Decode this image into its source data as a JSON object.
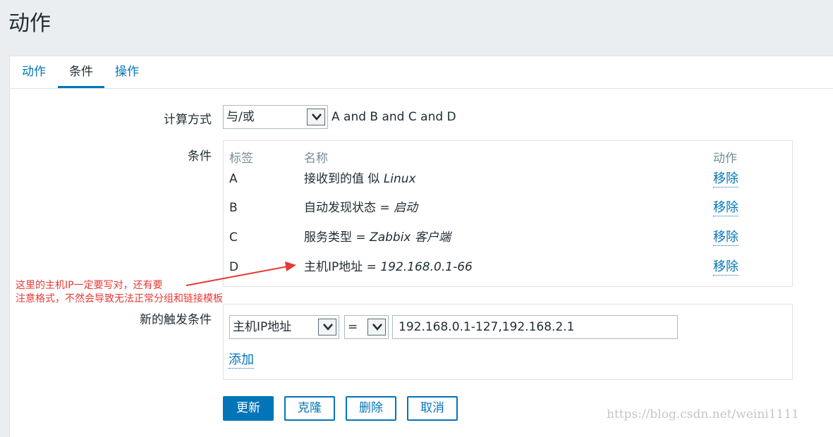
{
  "page": {
    "title": "动作"
  },
  "tabs": [
    {
      "label": "动作",
      "active": false
    },
    {
      "label": "条件",
      "active": true
    },
    {
      "label": "操作",
      "active": false
    }
  ],
  "calc": {
    "label": "计算方式",
    "selected": "与/或",
    "formula": "A and B and C and D"
  },
  "conditions": {
    "label": "条件",
    "headers": {
      "tag": "标签",
      "name": "名称",
      "action": "动作"
    },
    "rows": [
      {
        "tag": "A",
        "name_prefix": "接收到的值 似 ",
        "name_value": "Linux",
        "action": "移除"
      },
      {
        "tag": "B",
        "name_prefix": "自动发现状态 = ",
        "name_value": "启动",
        "action": "移除"
      },
      {
        "tag": "C",
        "name_prefix": "服务类型 = ",
        "name_value": "Zabbix 客户端",
        "action": "移除"
      },
      {
        "tag": "D",
        "name_prefix": "主机IP地址 = ",
        "name_value": "192.168.0.1-66",
        "action": "移除"
      }
    ]
  },
  "new_condition": {
    "label": "新的触发条件",
    "type_selected": "主机IP地址",
    "operator_selected": "=",
    "value": "192.168.0.1-127,192.168.2.1",
    "add_label": "添加"
  },
  "buttons": {
    "update": "更新",
    "clone": "克隆",
    "delete": "删除",
    "cancel": "取消"
  },
  "annotation": {
    "line1": "这里的主机IP一定要写对，还有要",
    "line2": "注意格式，不然会导致无法正常分组和链接模板"
  },
  "watermark": "https://blog.csdn.net/weini1111",
  "colors": {
    "accent": "#0275b8",
    "annotation": "#e53935",
    "background": "#ebeef0"
  }
}
